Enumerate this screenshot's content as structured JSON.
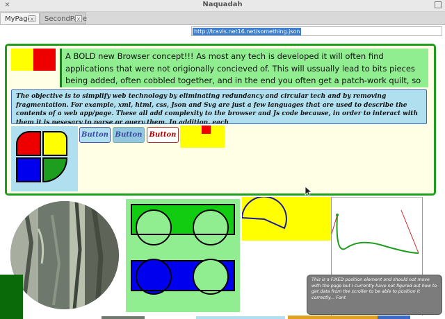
{
  "window": {
    "title": "Naquadah"
  },
  "tabs": [
    {
      "label": "MyPage",
      "close": "x"
    },
    {
      "label": "SecondPage",
      "close": "x"
    }
  ],
  "address": {
    "url": "http://travis.net16.net/something.json"
  },
  "content": {
    "intro_text": "A BOLD new Browser concept!!! As most any tech is developed it will often find applications that were not origionally concieved of. This will ussually lead to bits pieces being added, often cobbled together, and in the end you often get a patch-work quilt, so to speak. That is when simplification through",
    "objective_text": "The objective is to simplify web technology by eliminating redundancy and circular tech and by removing fragmentation. For example, xml, html, css, Json and Svg are just a few languages that are used to describe the contents of a web app/page. These all add complexity to the browser and Js code because, in order to interact with them it is nesesary to parse or query them. In addition, each",
    "buttons": [
      {
        "label": "Button"
      },
      {
        "label": "Button"
      },
      {
        "label": "Button"
      }
    ],
    "fixed_note": "This is a FIXED position element and should not move with the page but I currently have not figured out how to get data from the scroller to be able to position it correctly... Font"
  },
  "colors": {
    "panel_border": "#1e9e1e",
    "panel_bg": "#ffffe6",
    "accent_green": "#90ee90",
    "accent_blue": "#b0dff0",
    "yellow": "#ffff00",
    "red": "#ee0000",
    "blue": "#0000ee"
  },
  "icons": {
    "window_close": "close-icon",
    "window_maximize": "maximize-icon",
    "cursor": "mouse-cursor-icon"
  }
}
